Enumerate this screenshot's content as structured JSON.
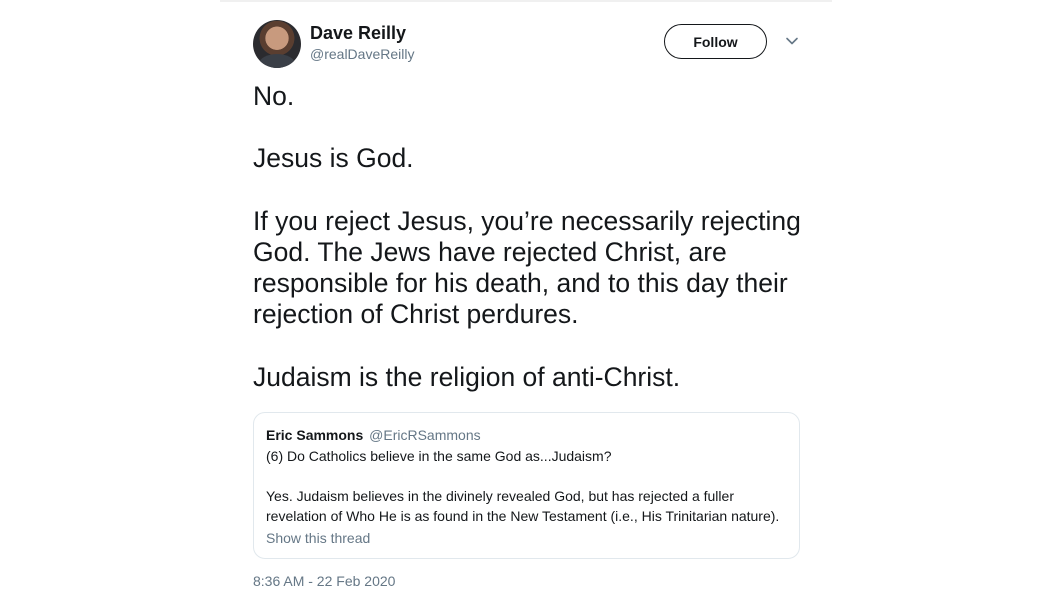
{
  "author": {
    "display_name": "Dave Reilly",
    "handle": "@realDaveReilly"
  },
  "follow_label": "Follow",
  "tweet": {
    "paragraphs": [
      "No.",
      "Jesus is God.",
      "If you reject Jesus, you’re necessarily rejecting God. The Jews have rejected Christ, are responsible for his death, and to this day their rejection of Christ perdures.",
      "Judaism is the religion of anti-Christ."
    ]
  },
  "quoted_tweet": {
    "display_name": "Eric Sammons",
    "handle": "@EricRSammons",
    "paragraphs": [
      "(6) Do Catholics believe in the same God as...Judaism?",
      "Yes. Judaism believes in the divinely revealed God, but has rejected a fuller revelation of Who He is as found in the New Testament (i.e., His Trinitarian nature)."
    ],
    "show_thread_label": "Show this thread"
  },
  "timestamp": "8:36 AM - 22 Feb 2020",
  "icons": {
    "menu": "chevron-down-icon"
  },
  "colors": {
    "text": "#14171a",
    "secondary": "#657786",
    "border": "#e1e8ed"
  }
}
